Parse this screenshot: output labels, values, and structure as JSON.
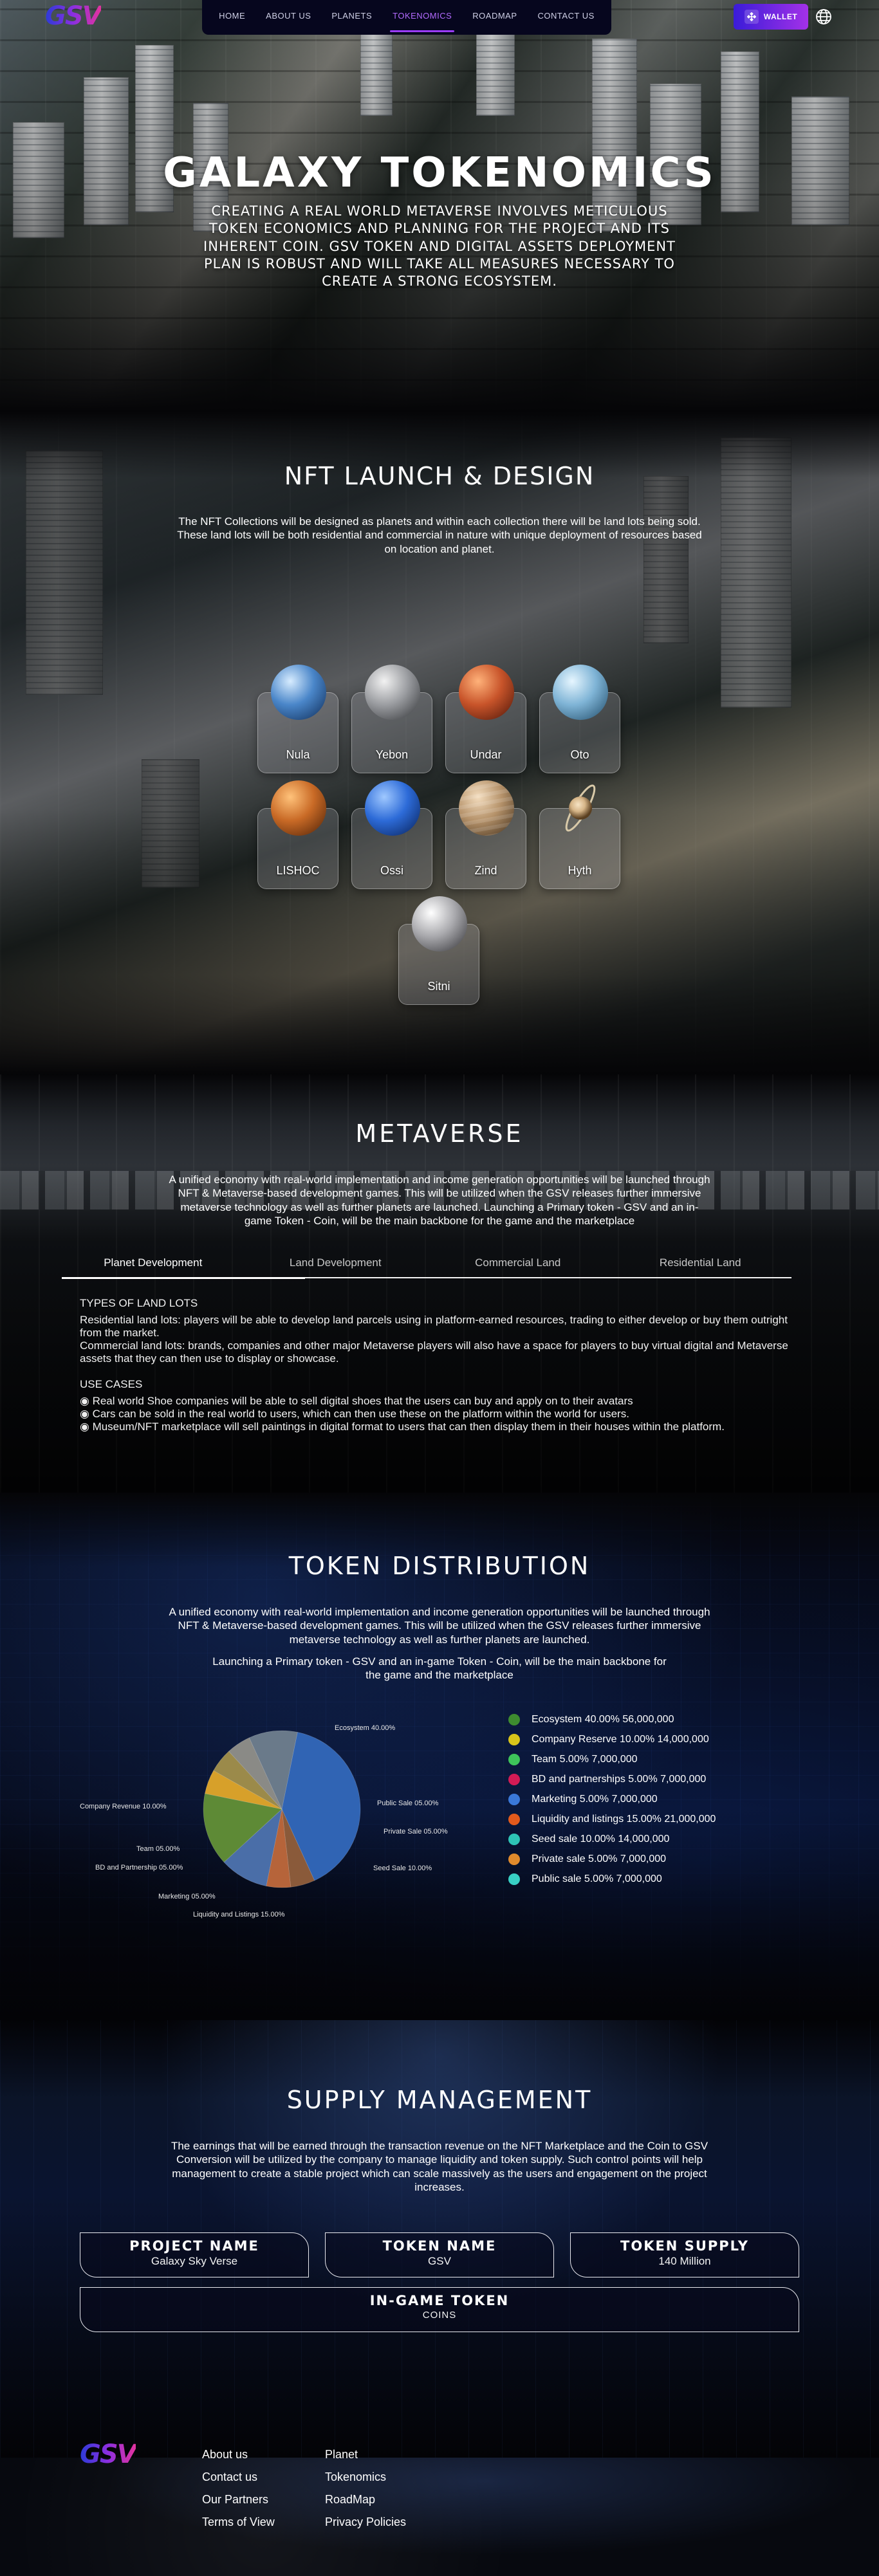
{
  "nav": {
    "logo": "GSV",
    "menu": [
      {
        "label": "HOME"
      },
      {
        "label": "ABOUT US"
      },
      {
        "label": "PLANETS"
      },
      {
        "label": "TOKENOMICS",
        "active": true
      },
      {
        "label": "ROADMAP"
      },
      {
        "label": "CONTACT US"
      }
    ],
    "wallet_label": "WALLET"
  },
  "hero": {
    "title": "GALAXY TOKENOMICS",
    "text": "CREATING A REAL WORLD METAVERSE INVOLVES METICULOUS TOKEN ECONOMICS AND PLANNING FOR THE PROJECT AND ITS INHERENT COIN. GSV TOKEN AND DIGITAL ASSETS DEPLOYMENT PLAN IS ROBUST AND WILL TAKE ALL MEASURES NECESSARY TO CREATE A STRONG ECOSYSTEM."
  },
  "nft": {
    "title": "NFT LAUNCH & DESIGN",
    "text": "The NFT Collections will be designed as planets and within each collection there will be land lots being sold. These land lots will be both residential and commercial in nature with unique deployment of resources based on location and planet.",
    "planets": [
      {
        "name": "Nula",
        "color": "#4a86c9"
      },
      {
        "name": "Yebon",
        "color": "#9b9da1"
      },
      {
        "name": "Undar",
        "color": "#c8542a"
      },
      {
        "name": "Oto",
        "color": "#7fb4d6"
      },
      {
        "name": "LISHOC",
        "color": "#c96a26"
      },
      {
        "name": "Ossi",
        "color": "#2d6bd8"
      },
      {
        "name": "Zind",
        "color": "#b5926a"
      },
      {
        "name": "Hyth",
        "color": "#d6b588"
      },
      {
        "name": "Sitni",
        "color": "#a9a9ad"
      }
    ]
  },
  "metaverse": {
    "title": "METAVERSE",
    "text": "A unified economy with real-world implementation and income generation opportunities will be launched through NFT & Metaverse-based development games. This will be utilized when the GSV releases further immersive metaverse technology as well as further planets are launched. Launching a Primary token - GSV and an in-game Token - Coin, will be the main backbone for the game and the marketplace",
    "tabs": [
      {
        "label": "Planet Development",
        "active": true
      },
      {
        "label": "Land Development"
      },
      {
        "label": "Commercial Land"
      },
      {
        "label": "Residential Land"
      }
    ],
    "types_heading": "TYPES OF LAND LOTS",
    "types_text_1": "Residential land lots: players will be able to develop land parcels using in platform-earned resources, trading to either develop or buy them outright from the market.",
    "types_text_2": "Commercial land lots: brands, companies and other major Metaverse players will also have a space for players to buy virtual digital and Metaverse assets that they can then use to display or showcase.",
    "use_heading": "USE CASES",
    "use_cases": [
      "Real world Shoe companies will be able to sell digital shoes that the users can buy and apply on to their avatars",
      "Cars can be sold in the real world to users, which can then use these on the platform within the world for users.",
      "Museum/NFT marketplace will sell paintings in digital format to users that can then display them in their houses within the platform."
    ]
  },
  "token": {
    "title": "TOKEN DISTRIBUTION",
    "text_1": "A unified economy with real-world implementation and income generation opportunities will be launched through NFT & Metaverse-based development games. This will be utilized when the GSV releases further immersive metaverse technology as well as further planets are launched.",
    "text_2": "Launching a Primary token - GSV and an in-game Token - Coin, will be the main backbone for the game and the marketplace",
    "legend": [
      {
        "label": "Ecosystem 40.00% 56,000,000",
        "color": "#3e8c2f"
      },
      {
        "label": "Company Reserve 10.00% 14,000,000",
        "color": "#d9c51a"
      },
      {
        "label": "Team 5.00% 7,000,000",
        "color": "#3ec45a"
      },
      {
        "label": "BD and partnerships 5.00% 7,000,000",
        "color": "#d31b55"
      },
      {
        "label": "Marketing 5.00% 7,000,000",
        "color": "#3a78d8"
      },
      {
        "label": "Liquidity and listings 15.00% 21,000,000",
        "color": "#e25a1c"
      },
      {
        "label": "Seed sale 10.00% 14,000,000",
        "color": "#2ec4b6"
      },
      {
        "label": "Private sale 5.00% 7,000,000",
        "color": "#e08a2c"
      },
      {
        "label": "Public sale 5.00% 7,000,000",
        "color": "#38d0c4"
      }
    ]
  },
  "chart_data": {
    "type": "pie",
    "title": "",
    "categories": [
      "Ecosystem",
      "Public Sale",
      "Private Sale",
      "Seed Sale",
      "Liquidity and Listings",
      "Marketing",
      "BD and Partnership",
      "Team",
      "Company Revenue"
    ],
    "values": [
      40,
      5,
      5,
      10,
      15,
      5,
      5,
      5,
      10
    ],
    "labels": [
      "Ecosystem 40.00%",
      "Public Sale 05.00%",
      "Private Sale 05.00%",
      "Seed Sale 10.00%",
      "Liquidity and Listings 15.00%",
      "Marketing 05.00%",
      "BD and Partnership 05.00%",
      "Team 05.00%",
      "Company Revenue 10.00%"
    ],
    "colors": [
      "#3064b4",
      "#8a5a3a",
      "#b6643a",
      "#4a6ea8",
      "#5e8a36",
      "#d7a02a",
      "#9b8a4a",
      "#8a8a86",
      "#6a7a8a"
    ]
  },
  "supply": {
    "title": "SUPPLY MANAGEMENT",
    "text": "The earnings that will be earned through the transaction revenue on the NFT Marketplace and the Coin to GSV Conversion will be utilized by the company to manage liquidity and token supply. Such control points will help management to create a stable project which can scale massively as the users and engagement on the project increases.",
    "boxes": [
      {
        "title": "PROJECT NAME",
        "value": "Galaxy Sky Verse"
      },
      {
        "title": "TOKEN NAME",
        "value": "GSV"
      },
      {
        "title": "TOKEN SUPPLY",
        "value": "140 Million"
      },
      {
        "title": "IN-GAME TOKEN",
        "value": "COINS"
      }
    ]
  },
  "footer": {
    "logo": "GSV",
    "col1": [
      "About us",
      "Contact us",
      "Our Partners",
      "Terms of View"
    ],
    "col2": [
      "Planet",
      "Tokenomics",
      "RoadMap",
      "Privacy Policies"
    ]
  }
}
